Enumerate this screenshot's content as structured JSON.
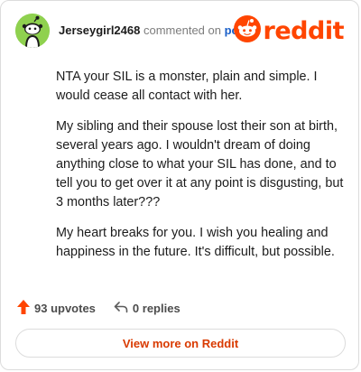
{
  "header": {
    "username": "Jerseygirl2468",
    "commented_on": "commented on",
    "post_link": "post",
    "logo_text": "reddit"
  },
  "comment": {
    "paragraphs": [
      "NTA your SIL is a monster, plain and simple. I would cease all contact with her.",
      "My sibling and their spouse lost their son at birth, several years ago. I wouldn't dream of doing anything close to what your SIL has done, and to tell you to get over it at any point is disgusting, but 3 months later???",
      "My heart breaks for you. I wish you healing and happiness in the future. It's difficult, but possible."
    ]
  },
  "footer": {
    "upvotes": "93 upvotes",
    "replies": "0 replies"
  },
  "view_more_label": "View more on Reddit",
  "colors": {
    "brand": "#ff4500",
    "link": "#1a5fc8",
    "avatar_bg": "#8fd14f"
  },
  "icons": {
    "avatar": "snoo-avatar-icon",
    "logo": "reddit-snoo-icon",
    "upvote": "upvote-arrow-icon",
    "reply": "reply-arrow-icon"
  }
}
